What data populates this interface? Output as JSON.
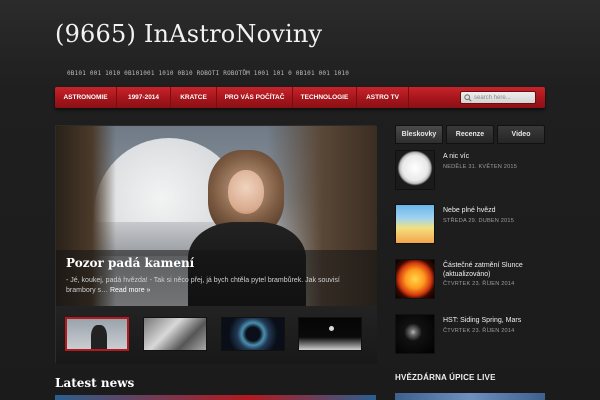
{
  "site": {
    "title": "(9665) InAstroNoviny",
    "tagline": "0B101 001  1010 0B101001 1010  0B10 ROBOTI ROBOTŮM 1001 101 0 0B101 001 1010"
  },
  "nav": {
    "items": [
      {
        "label": "ASTRONOMIE"
      },
      {
        "label": "1997-2014"
      },
      {
        "label": "KRATCE"
      },
      {
        "label": "PRO VÁS POČÍTAČ"
      },
      {
        "label": "TECHNOLOGIE"
      },
      {
        "label": "ASTRO TV"
      }
    ],
    "search_placeholder": "search here..."
  },
  "slider": {
    "title": "Pozor padá kamení",
    "excerpt": "- Jé, koukej, padá hvězda! - Tak si něco přej, já bych chtěla pytel brambůrek. Jak souvisí brambory s…",
    "more": "Read more »"
  },
  "latest": {
    "heading": "Latest news"
  },
  "sidebar": {
    "tabs": [
      {
        "label": "Bleskovky"
      },
      {
        "label": "Recenze"
      },
      {
        "label": "Video"
      }
    ],
    "posts": [
      {
        "title": "A nic víc",
        "date": "NEDĚLE 31. KVĚTEN 2015"
      },
      {
        "title": "Nebe plné hvězd",
        "date": "STŘEDA 29. DUBEN 2015"
      },
      {
        "title": "Částečné zatmění Slunce (aktualizováno)",
        "date": "ČTVRTEK 23. ŘÍJEN 2014"
      },
      {
        "title": "HST: Siding Spring, Mars",
        "date": "ČTVRTEK 23. ŘÍJEN 2014"
      }
    ],
    "live_heading": "HVĚZDÁRNA ÚPICE LIVE"
  },
  "colors": {
    "accent": "#b3191f",
    "background": "#1e1e1e"
  }
}
